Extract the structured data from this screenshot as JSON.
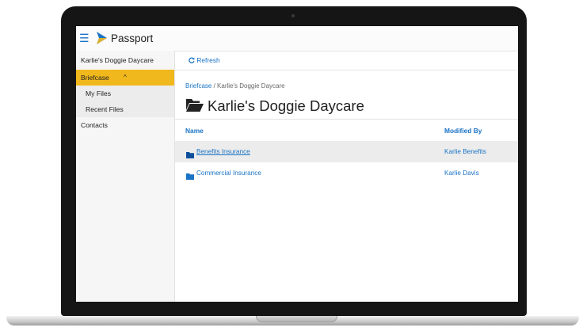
{
  "app": {
    "name": "Passport"
  },
  "sidebar": {
    "org": "Karlie's Doggie Daycare",
    "briefcase": "Briefcase",
    "briefcase_chevron": "^",
    "my_files": "My Files",
    "recent_files": "Recent Files",
    "contacts": "Contacts"
  },
  "toolbar": {
    "refresh_label": "Refresh"
  },
  "breadcrumb": {
    "root": "Briefcase",
    "separator": " / ",
    "current": "Karlie's Doggie Daycare"
  },
  "page": {
    "title": "Karlie's Doggie Daycare"
  },
  "table": {
    "columns": {
      "name": "Name",
      "modified_by": "Modified By"
    },
    "rows": [
      {
        "name": "Benefits Insurance",
        "modified_by": "Karlie Benefits",
        "selected": true
      },
      {
        "name": "Commercial Insurance",
        "modified_by": "Karlie Davis",
        "selected": false
      }
    ]
  },
  "icons": {
    "menu": "hamburger-icon",
    "logo": "passport-logo-icon",
    "refresh": "refresh-icon",
    "folder_open": "folder-open-icon",
    "folder": "folder-icon"
  },
  "colors": {
    "accent": "#1a73c5",
    "active": "#f0b81c"
  }
}
